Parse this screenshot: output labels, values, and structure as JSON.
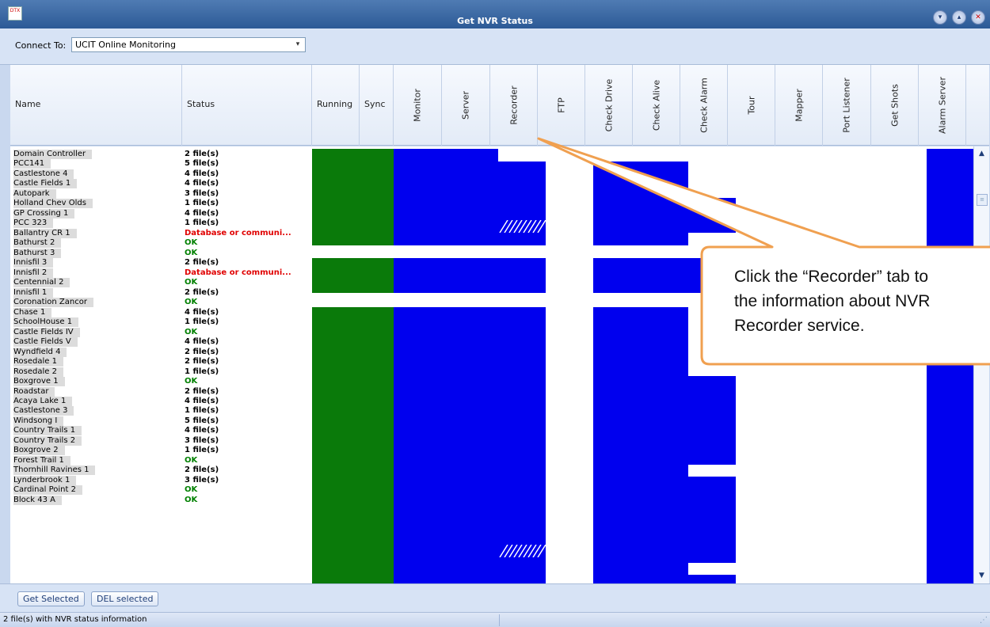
{
  "window": {
    "icon_text": "DTX",
    "title": "Get NVR Status",
    "buttons": {
      "minimize": "▾",
      "maximize": "▴",
      "close": "✕"
    }
  },
  "connect": {
    "label": "Connect To:",
    "value": "UCIT Online Monitoring",
    "arrow": "▾"
  },
  "columns": {
    "name": "Name",
    "status": "Status",
    "running": "Running",
    "sync": "Sync",
    "monitor": "Monitor",
    "server": "Server",
    "recorder": "Recorder",
    "ftp": "FTP",
    "check_drive": "Check Drive",
    "check_alive": "Check Alive",
    "check_alarm": "Check Alarm",
    "tour": "Tour",
    "mapper": "Mapper",
    "port_listener": "Port Listener",
    "get_shots": "Get Shots",
    "alarm_server": "Alarm Server"
  },
  "rows": [
    {
      "name": "Domain Controller",
      "status": "2 file(s)",
      "state": "files"
    },
    {
      "name": "PCC141",
      "status": "5 file(s)",
      "state": "files"
    },
    {
      "name": "Castlestone 4",
      "status": "4 file(s)",
      "state": "files"
    },
    {
      "name": "Castle Fields 1",
      "status": "4 file(s)",
      "state": "files"
    },
    {
      "name": "Autopark",
      "status": "3 file(s)",
      "state": "files"
    },
    {
      "name": "Holland Chev Olds",
      "status": "1 file(s)",
      "state": "files"
    },
    {
      "name": "GP Crossing 1",
      "status": "4 file(s)",
      "state": "files"
    },
    {
      "name": "PCC 323",
      "status": "1 file(s)",
      "state": "files"
    },
    {
      "name": "Ballantry CR 1",
      "status": "Database or communi...",
      "state": "error"
    },
    {
      "name": "Bathurst 2",
      "status": "OK",
      "state": "ok"
    },
    {
      "name": "Bathurst 3",
      "status": "OK",
      "state": "ok"
    },
    {
      "name": "Innisfil 3",
      "status": "2 file(s)",
      "state": "files"
    },
    {
      "name": "Innisfil 2",
      "status": "Database or communi...",
      "state": "error"
    },
    {
      "name": "Centennial 2",
      "status": "OK",
      "state": "ok"
    },
    {
      "name": "Innisfil 1",
      "status": "2 file(s)",
      "state": "files"
    },
    {
      "name": "Coronation Zancor",
      "status": "OK",
      "state": "ok"
    },
    {
      "name": "Chase 1",
      "status": "4 file(s)",
      "state": "files"
    },
    {
      "name": "SchoolHouse 1",
      "status": "1 file(s)",
      "state": "files"
    },
    {
      "name": "Castle Fields IV",
      "status": "OK",
      "state": "ok"
    },
    {
      "name": "Castle Fields V",
      "status": "4 file(s)",
      "state": "files"
    },
    {
      "name": "Wyndfield 4",
      "status": "2 file(s)",
      "state": "files"
    },
    {
      "name": "Rosedale 1",
      "status": "2 file(s)",
      "state": "files"
    },
    {
      "name": "Rosedale 2",
      "status": "1 file(s)",
      "state": "files"
    },
    {
      "name": "Boxgrove 1",
      "status": "OK",
      "state": "ok"
    },
    {
      "name": "Roadstar",
      "status": "2 file(s)",
      "state": "files"
    },
    {
      "name": "Acaya Lake 1",
      "status": "4 file(s)",
      "state": "files"
    },
    {
      "name": "Castlestone 3",
      "status": "1 file(s)",
      "state": "files"
    },
    {
      "name": "Windsong I",
      "status": "5 file(s)",
      "state": "files"
    },
    {
      "name": "Country Trails 1",
      "status": "4 file(s)",
      "state": "files"
    },
    {
      "name": "Country Trails 2",
      "status": "3 file(s)",
      "state": "files"
    },
    {
      "name": "Boxgrove 2",
      "status": "1 file(s)",
      "state": "files"
    },
    {
      "name": "Forest Trail 1",
      "status": "OK",
      "state": "ok"
    },
    {
      "name": "Thornhill Ravines 1",
      "status": "2 file(s)",
      "state": "files"
    },
    {
      "name": "Lynderbrook 1",
      "status": "3 file(s)",
      "state": "files"
    },
    {
      "name": "Cardinal Point 2",
      "status": "OK",
      "state": "ok"
    },
    {
      "name": "Block 43 A",
      "status": "OK",
      "state": "ok"
    }
  ],
  "colors": {
    "running": "#0a7a0a",
    "active": "#0000ee",
    "error_text": "#e00000",
    "ok_text": "#008000",
    "files_text": "#000000",
    "callout_border": "#f0a050"
  },
  "scrollbar": {
    "up": "▲",
    "down": "▼",
    "thumb": "≡"
  },
  "buttons": {
    "get_selected": "Get Selected",
    "del_selected": "DEL selected"
  },
  "status_bar": {
    "text": "2 file(s) with NVR status information",
    "grip": "⋰"
  },
  "callout": {
    "lines": [
      "Click the “Recorder” tab to",
      "the information about NVR",
      "Recorder service."
    ]
  }
}
